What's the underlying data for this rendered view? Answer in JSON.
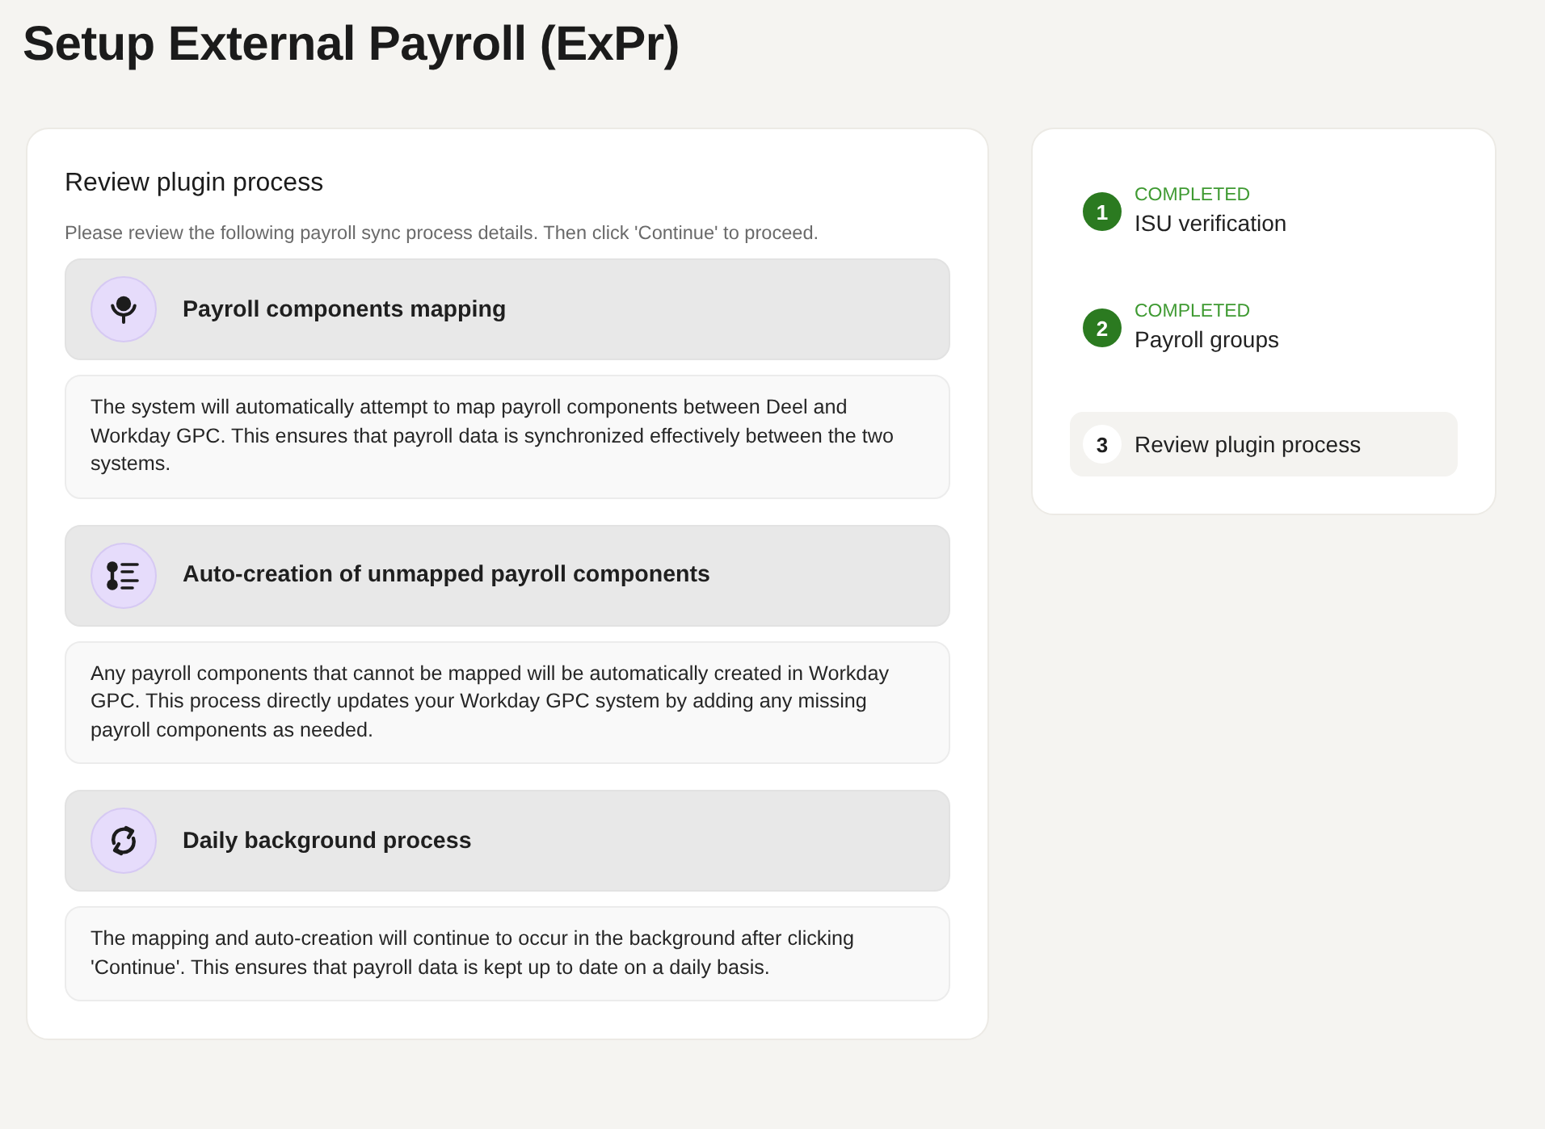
{
  "page": {
    "title": "Setup External Payroll (ExPr)"
  },
  "review_card": {
    "title": "Review plugin process",
    "subtitle": "Please review the following payroll sync process details. Then click 'Continue' to proceed.",
    "sections": [
      {
        "title": "Payroll components mapping",
        "description": "The system will automatically attempt to map payroll components between Deel and Workday GPC. This ensures that payroll data is synchronized effectively between the two systems."
      },
      {
        "title": "Auto-creation of unmapped payroll components",
        "description": "Any payroll components that cannot be mapped will be automatically created in Workday GPC. This process directly updates your Workday GPC system by adding any missing payroll components as needed."
      },
      {
        "title": "Daily background process",
        "description": "The mapping and auto-creation will continue to occur in the background after clicking 'Continue'. This ensures that payroll data is kept up to date on a daily basis."
      }
    ]
  },
  "steps": [
    {
      "number": "1",
      "status": "COMPLETED",
      "label": "ISU verification",
      "completed": true,
      "selected": false
    },
    {
      "number": "2",
      "status": "COMPLETED",
      "label": "Payroll groups",
      "completed": true,
      "selected": false
    },
    {
      "number": "3",
      "label": "Review plugin process",
      "completed": false,
      "selected": true
    }
  ]
}
